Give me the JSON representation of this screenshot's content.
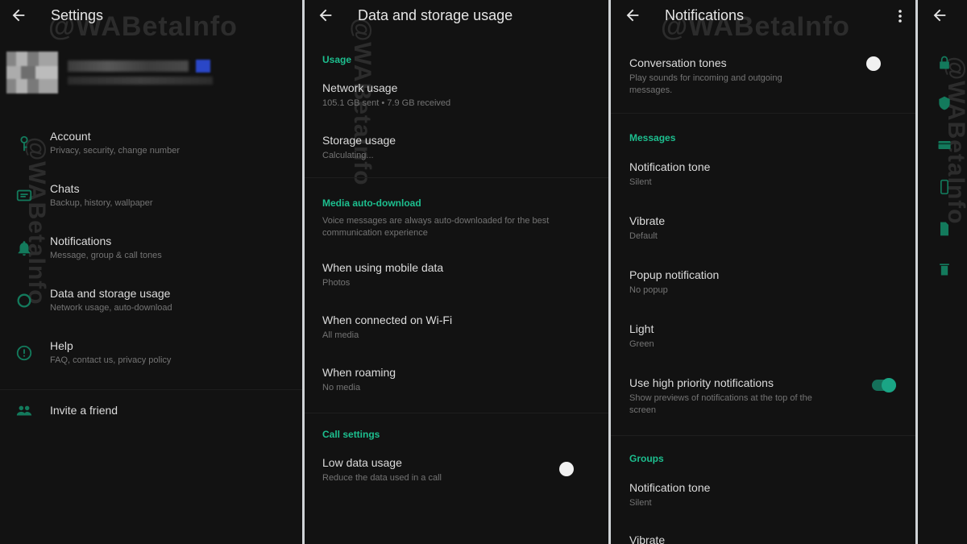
{
  "colors": {
    "accent": "#1dbf8f",
    "background": "#121212",
    "toggle_on": "#1aa585",
    "toggle_off": "#f1f1f1"
  },
  "watermark": "@WABetaInfo",
  "settings": {
    "title": "Settings",
    "items": [
      {
        "label": "Account",
        "sub": "Privacy, security, change number",
        "icon": "key-icon"
      },
      {
        "label": "Chats",
        "sub": "Backup, history, wallpaper",
        "icon": "chat-icon"
      },
      {
        "label": "Notifications",
        "sub": "Message, group & call tones",
        "icon": "bell-icon"
      },
      {
        "label": "Data and storage usage",
        "sub": "Network usage, auto-download",
        "icon": "data-usage-icon"
      },
      {
        "label": "Help",
        "sub": "FAQ, contact us, privacy policy",
        "icon": "help-icon"
      }
    ],
    "invite": {
      "label": "Invite a friend",
      "icon": "people-icon"
    }
  },
  "data_storage": {
    "title": "Data and storage usage",
    "usage_header": "Usage",
    "network_usage": {
      "label": "Network usage",
      "sub": "105.1 GB sent • 7.9 GB received"
    },
    "storage_usage": {
      "label": "Storage usage",
      "sub": "Calculating..."
    },
    "media_header": "Media auto-download",
    "media_note_1": "Voice messages are always auto-downloaded for the best",
    "media_note_2": "communication experience",
    "mobile_data": {
      "label": "When using mobile data",
      "sub": "Photos"
    },
    "wifi": {
      "label": "When connected on Wi-Fi",
      "sub": "All media"
    },
    "roaming": {
      "label": "When roaming",
      "sub": "No media"
    },
    "call_header": "Call settings",
    "low_data": {
      "label": "Low data usage",
      "sub": "Reduce the data used in a call",
      "enabled": false
    }
  },
  "notifications": {
    "title": "Notifications",
    "conversation_tones": {
      "label": "Conversation tones",
      "sub1": "Play sounds for incoming and outgoing",
      "sub2": "messages.",
      "enabled": false
    },
    "messages_header": "Messages",
    "tone": {
      "label": "Notification tone",
      "sub": "Silent"
    },
    "vibrate": {
      "label": "Vibrate",
      "sub": "Default"
    },
    "popup": {
      "label": "Popup notification",
      "sub": "No popup"
    },
    "light": {
      "label": "Light",
      "sub": "Green"
    },
    "high_priority": {
      "label": "Use high priority notifications",
      "sub1": "Show previews of notifications at the top of the",
      "sub2": "screen",
      "enabled": true
    },
    "groups_header": "Groups",
    "group_tone": {
      "label": "Notification tone",
      "sub": "Silent"
    },
    "group_vibrate": {
      "label": "Vibrate"
    }
  }
}
